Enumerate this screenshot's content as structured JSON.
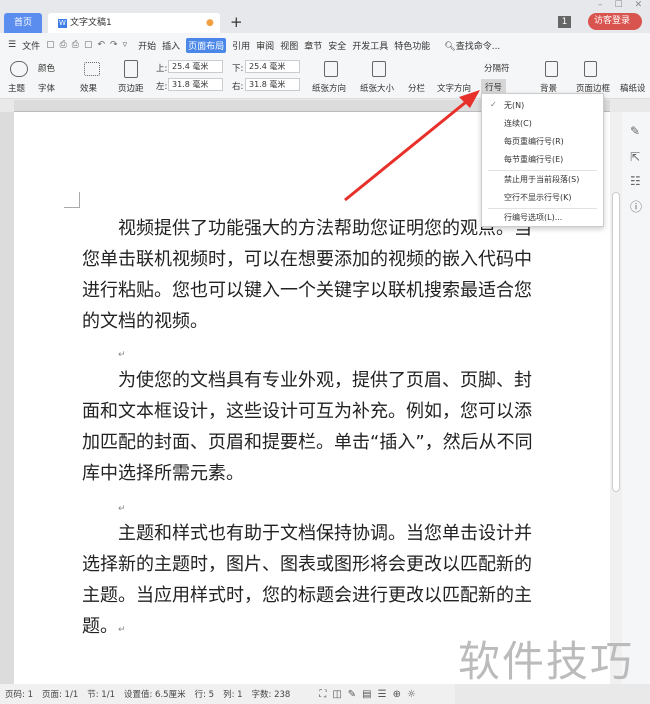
{
  "window": {
    "controls": [
      "–",
      "☐",
      "✕"
    ]
  },
  "tabs": {
    "home": "首页",
    "doc": "文字文稿1",
    "new": "+",
    "badge": "1",
    "login": "访客登录"
  },
  "menu": {
    "file": "文件",
    "items": [
      "开始",
      "插入",
      "页面布局",
      "引用",
      "审阅",
      "视图",
      "章节",
      "安全",
      "开发工具",
      "特色功能"
    ],
    "active_index": 2,
    "search": "查找命令..."
  },
  "ribbon": {
    "theme": "主题",
    "colors": "颜色",
    "font": "字体",
    "effects": "效果",
    "margins": "页边距",
    "top_label": "上:",
    "top": "25.4 毫米",
    "bottom_label": "下:",
    "bottom": "25.4 毫米",
    "left_label": "左:",
    "left": "31.8 毫米",
    "right_label": "右:",
    "right": "31.8 毫米",
    "orientation": "纸张方向",
    "size": "纸张大小",
    "columns": "分栏",
    "text_direction": "文字方向",
    "breaks": "分隔符",
    "line_numbers": "行号",
    "background": "背景",
    "page_border": "页面边框",
    "draft": "稿纸设"
  },
  "dropdown": {
    "items": [
      "无(N)",
      "连续(C)",
      "每页重编行号(R)",
      "每节重编行号(E)",
      "禁止用于当前段落(S)",
      "空行不显示行号(K)",
      "行编号选项(L)..."
    ],
    "checked": "✓"
  },
  "document": {
    "paragraphs": [
      "视频提供了功能强大的方法帮助您证明您的观点。当您单击联机视频时，可以在想要添加的视频的嵌入代码中进行粘贴。您也可以键入一个关键字以联机搜索最适合您的文档的视频。",
      "为使您的文档具有专业外观，提供了页眉、页脚、封面和文本框设计，这些设计可互为补充。例如，您可以添加匹配的封面、页眉和提要栏。单击“插入”，然后从不同库中选择所需元素。",
      "主题和样式也有助于文档保持协调。当您单击设计并选择新的主题时，图片、图表或图形将会更改以匹配新的主题。当应用样式时，您的标题会进行更改以匹配新的主题。"
    ],
    "return_mark": "↵"
  },
  "status": {
    "page": "页码: 1",
    "pages": "页面: 1/1",
    "section": "节: 1/1",
    "setting": "设置值: 6.5厘米",
    "row": "行: 5",
    "col": "列: 1",
    "words": "字数: 238"
  },
  "watermark": "软件技巧"
}
